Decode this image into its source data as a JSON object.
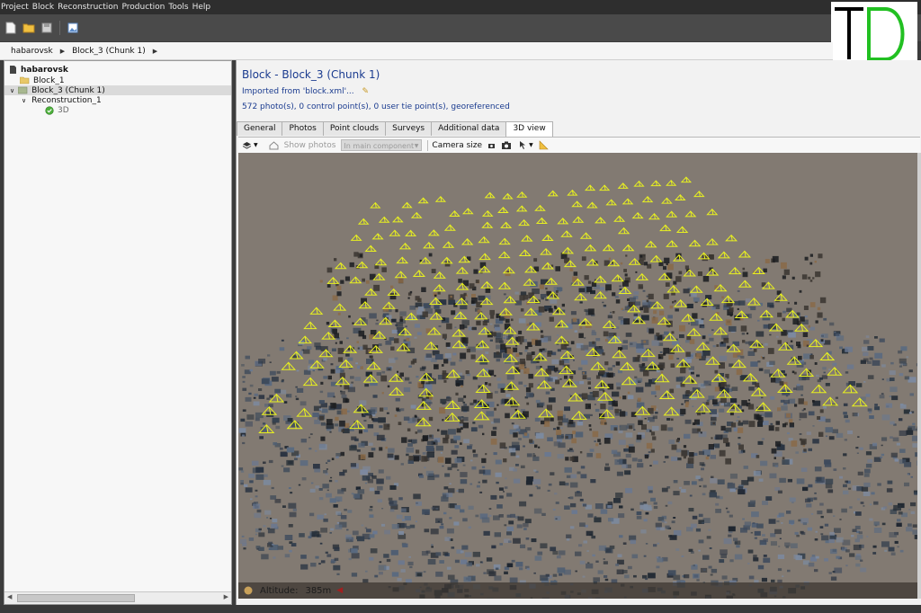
{
  "menu": [
    "Project",
    "Block",
    "Reconstruction",
    "Production",
    "Tools",
    "Help"
  ],
  "logo": {
    "letter1": "T",
    "letter2": "D",
    "color1": "#000000",
    "color2": "#22c022"
  },
  "breadcrumb": {
    "project": "habarovsk",
    "block": "Block_3 (Chunk 1)"
  },
  "tree": {
    "root": "habarovsk",
    "block1": "Block_1",
    "block3": "Block_3 (Chunk 1)",
    "reconstruction": "Reconstruction_1",
    "production": "3D"
  },
  "block": {
    "title": "Block - Block_3 (Chunk 1)",
    "imported": "Imported from 'block.xml'...",
    "info": "572 photo(s), 0 control point(s), 0 user tie point(s), georeferenced"
  },
  "tabs": [
    "General",
    "Photos",
    "Point clouds",
    "Surveys",
    "Additional data",
    "3D view"
  ],
  "active_tab": "3D view",
  "view_toolbar": {
    "show_photos": "Show photos",
    "dropdown": "In main component",
    "camera_size": "Camera size"
  },
  "status": {
    "altitude_label": "Altitude:",
    "altitude_value": "385m"
  },
  "colors": {
    "accent_blue": "#1a3b8f",
    "camera_yellow": "#e8f020",
    "ground_base": "#827a72"
  }
}
